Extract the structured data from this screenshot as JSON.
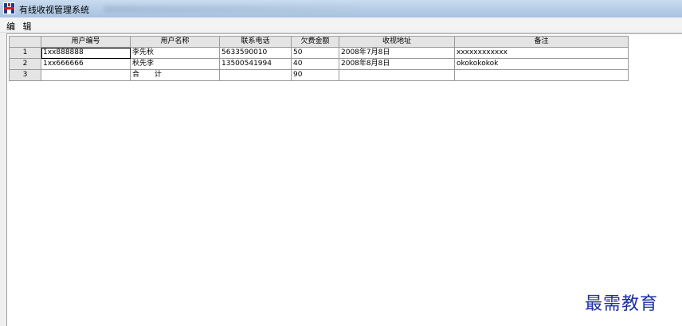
{
  "window": {
    "title": "有线收视管理系统",
    "icon": "app-logo-icon"
  },
  "menu": {
    "items": [
      "编 辑"
    ]
  },
  "table": {
    "columns": [
      "",
      "用户编号",
      "用户名称",
      "联系电话",
      "欠费金额",
      "收视地址",
      "备注"
    ],
    "rows": [
      {
        "num": "1",
        "cells": [
          "1xx888888",
          "李先秋",
          "5633590010",
          "50",
          "2008年7月8日",
          "xxxxxxxxxxxx"
        ]
      },
      {
        "num": "2",
        "cells": [
          "1xx666666",
          "秋先李",
          "13500541994",
          "40",
          "2008年8月8日",
          "okokokokok"
        ]
      },
      {
        "num": "3",
        "cells": [
          "",
          "合 计",
          "",
          "90",
          "",
          ""
        ]
      }
    ]
  },
  "watermark": "最需教育"
}
